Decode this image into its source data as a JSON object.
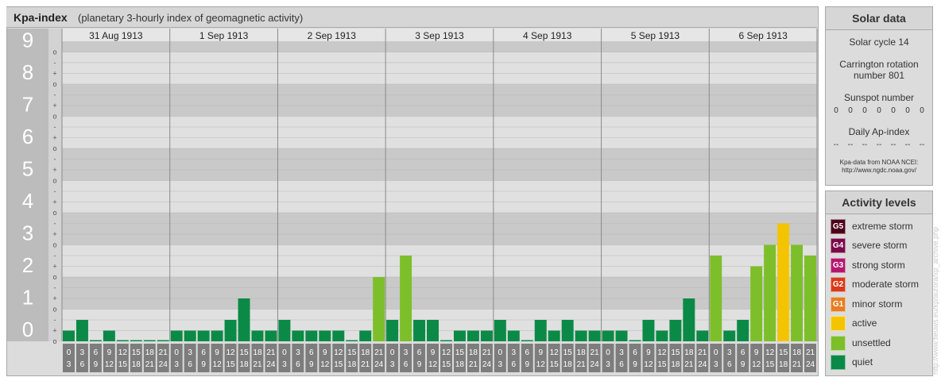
{
  "header": {
    "title": "Kpa-index",
    "subtitle": "(planetary 3-hourly index of geomagnetic activity)"
  },
  "solar": {
    "heading": "Solar data",
    "cycle": "Solar cycle 14",
    "carrington_line1": "Carrington rotation",
    "carrington_line2": "number 801",
    "sunspot_label": "Sunspot number",
    "sunspot_values": [
      "0",
      "0",
      "0",
      "0",
      "0",
      "0",
      "0"
    ],
    "ap_label": "Daily Ap-index",
    "ap_values": [
      "--",
      "--",
      "--",
      "--",
      "--",
      "--",
      "--"
    ],
    "source_line1": "Kpa-data from NOAA NCEI:",
    "source_line2": "http://www.ngdc.noaa.gov/"
  },
  "activity": {
    "heading": "Activity levels",
    "levels": [
      {
        "code": "G5",
        "label": "extreme storm",
        "color": "#4d0019"
      },
      {
        "code": "G4",
        "label": "severe storm",
        "color": "#7a0b4a"
      },
      {
        "code": "G3",
        "label": "strong storm",
        "color": "#b5176f"
      },
      {
        "code": "G2",
        "label": "moderate storm",
        "color": "#d93a1c"
      },
      {
        "code": "G1",
        "label": "minor storm",
        "color": "#e67e22"
      },
      {
        "code": "",
        "label": "active",
        "color": "#f5c400"
      },
      {
        "code": "",
        "label": "unsettled",
        "color": "#7dbf2a"
      },
      {
        "code": "",
        "label": "quiet",
        "color": "#0a8a46"
      }
    ]
  },
  "watermark": "http://www.fieuws.eu/kp/aurora/xp_archive.php",
  "chart_data": {
    "type": "bar",
    "y_ticks": [
      "0",
      "1",
      "2",
      "3",
      "4",
      "5",
      "6",
      "7",
      "8",
      "9"
    ],
    "minor_marks": [
      "o",
      "+",
      "-"
    ],
    "ylim": [
      0,
      9.333
    ],
    "days": [
      "31 Aug 1913",
      "1 Sep 1913",
      "2 Sep 1913",
      "3 Sep 1913",
      "4 Sep 1913",
      "5 Sep 1913",
      "6 Sep 1913"
    ],
    "intervals_top": [
      "0",
      "3",
      "6",
      "9",
      "12",
      "15",
      "18",
      "21"
    ],
    "intervals_bottom": [
      "3",
      "6",
      "9",
      "12",
      "15",
      "18",
      "21",
      "24"
    ],
    "series": [
      {
        "values": [
          0.333,
          0.667,
          0.0,
          0.333,
          0.0,
          0.0,
          0.0,
          0.0,
          0.333,
          0.333,
          0.333,
          0.333,
          0.667,
          1.333,
          0.333,
          0.333,
          0.667,
          0.333,
          0.333,
          0.333,
          0.333,
          0.0,
          0.333,
          2.0,
          0.667,
          2.667,
          0.667,
          0.667,
          0.0,
          0.333,
          0.333,
          0.333,
          0.667,
          0.333,
          0.0,
          0.667,
          0.333,
          0.667,
          0.333,
          0.333,
          0.333,
          0.333,
          0.0,
          0.667,
          0.333,
          0.667,
          1.333,
          0.333,
          2.667,
          0.333,
          0.667,
          2.333,
          3.0,
          3.667,
          3.0,
          2.667
        ],
        "levels": [
          "quiet",
          "quiet",
          "quiet",
          "quiet",
          "quiet",
          "quiet",
          "quiet",
          "quiet",
          "quiet",
          "quiet",
          "quiet",
          "quiet",
          "quiet",
          "quiet",
          "quiet",
          "quiet",
          "quiet",
          "quiet",
          "quiet",
          "quiet",
          "quiet",
          "quiet",
          "quiet",
          "unsettled",
          "quiet",
          "unsettled",
          "quiet",
          "quiet",
          "quiet",
          "quiet",
          "quiet",
          "quiet",
          "quiet",
          "quiet",
          "quiet",
          "quiet",
          "quiet",
          "quiet",
          "quiet",
          "quiet",
          "quiet",
          "quiet",
          "quiet",
          "quiet",
          "quiet",
          "quiet",
          "quiet",
          "quiet",
          "unsettled",
          "quiet",
          "quiet",
          "unsettled",
          "unsettled",
          "active",
          "unsettled",
          "unsettled"
        ]
      }
    ],
    "colors": {
      "quiet": "#0a8a46",
      "unsettled": "#7dbf2a",
      "active": "#f5c400"
    }
  }
}
